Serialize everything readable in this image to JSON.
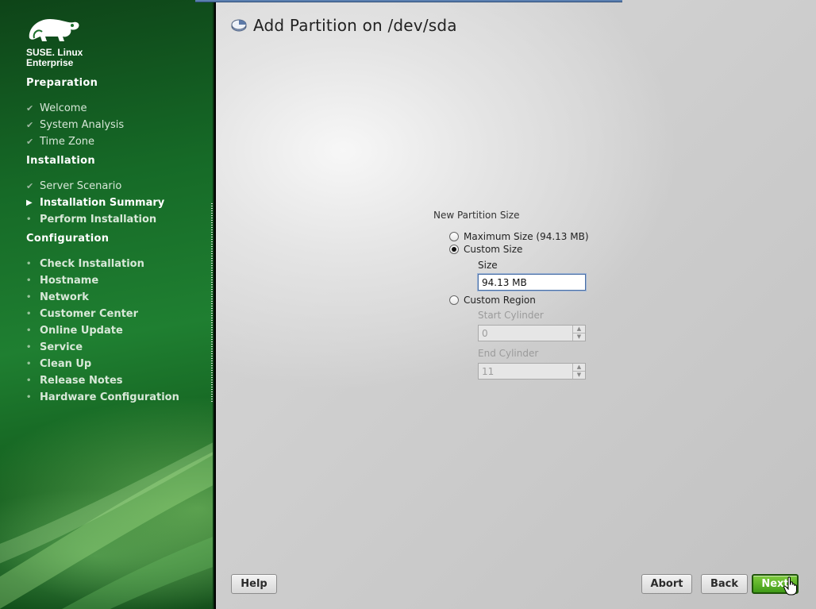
{
  "brand": {
    "line1": "SUSE. Linux",
    "line2": "Enterprise"
  },
  "sidebar": {
    "sections": [
      {
        "title": "Preparation"
      },
      {
        "title": "Installation"
      },
      {
        "title": "Configuration"
      }
    ],
    "steps": [
      {
        "label": "Welcome",
        "state": "done"
      },
      {
        "label": "System Analysis",
        "state": "done"
      },
      {
        "label": "Time Zone",
        "state": "done"
      },
      {
        "label": "Server Scenario",
        "state": "done"
      },
      {
        "label": "Installation Summary",
        "state": "current"
      },
      {
        "label": "Perform Installation",
        "state": "pending"
      },
      {
        "label": "Check Installation",
        "state": "pending"
      },
      {
        "label": "Hostname",
        "state": "pending"
      },
      {
        "label": "Network",
        "state": "pending"
      },
      {
        "label": "Customer Center",
        "state": "pending"
      },
      {
        "label": "Online Update",
        "state": "pending"
      },
      {
        "label": "Service",
        "state": "pending"
      },
      {
        "label": "Clean Up",
        "state": "pending"
      },
      {
        "label": "Release Notes",
        "state": "pending"
      },
      {
        "label": "Hardware Configuration",
        "state": "pending"
      }
    ]
  },
  "main": {
    "title": "Add Partition on /dev/sda",
    "title_icon": "disk-icon",
    "group_label": "New Partition Size",
    "options": {
      "max_size": {
        "label": "Maximum Size (94.13 MB)",
        "checked": false
      },
      "custom_size": {
        "label": "Custom Size",
        "checked": true
      },
      "custom_region": {
        "label": "Custom Region",
        "checked": false
      }
    },
    "size_field": {
      "label": "Size",
      "value": "94.13 MB"
    },
    "start_cylinder": {
      "label": "Start Cylinder",
      "value": "0",
      "enabled": false
    },
    "end_cylinder": {
      "label": "End Cylinder",
      "value": "11",
      "enabled": false
    }
  },
  "buttons": {
    "help": "Help",
    "abort": "Abort",
    "back": "Back",
    "next": "Next"
  },
  "colors": {
    "sidebar_green": "#1f7f31",
    "next_green": "#3f9a17",
    "accent_blue": "#5b7fb0"
  }
}
